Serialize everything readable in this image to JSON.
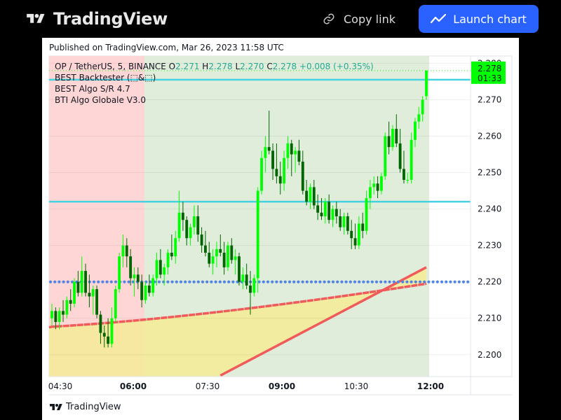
{
  "header": {
    "brand": "TradingView",
    "copy_link_label": "Copy link",
    "launch_label": "Launch chart"
  },
  "published_text": "Published on TradingView.com, Mar 26, 2023 11:58 UTC",
  "footer_brand": "TradingView",
  "legend": {
    "symbol": "OP / TetherUS, 5, BINANCE",
    "o_label": "O",
    "o_value": "2.271",
    "h_label": "H",
    "h_value": "2.278",
    "l_label": "L",
    "l_value": "2.270",
    "c_label": "C",
    "c_value": "2.278",
    "change": "+0.008 (+0.35%)",
    "indicators": [
      "BEST Backtester (⬚&⬚)",
      "BEST Algo S/R 4.7",
      "BTI Algo Globale V3.0"
    ]
  },
  "price_badge": {
    "price": "2.278",
    "countdown": "01:33"
  },
  "colors": {
    "up": "#00ff00",
    "down": "#006400",
    "accent": "#2962ff",
    "sr_line": "#44d2e0",
    "dots": "#4f83e6",
    "ma_red": "#f15a5a",
    "zone_red": "#ffd6d6",
    "zone_green": "#e1eddb",
    "fill_yellow": "#f5eb96"
  },
  "chart_data": {
    "type": "candlestick",
    "quote_unit": "USDT",
    "ylim": [
      2.194,
      2.282
    ],
    "y_ticks": [
      "2.280",
      "2.270",
      "2.260",
      "2.250",
      "2.240",
      "2.230",
      "2.220",
      "2.210",
      "2.200"
    ],
    "x_ticks": [
      {
        "label": "04:30",
        "bold": false
      },
      {
        "label": "06:00",
        "bold": true
      },
      {
        "label": "07:30",
        "bold": false
      },
      {
        "label": "09:00",
        "bold": true
      },
      {
        "label": "10:30",
        "bold": false
      },
      {
        "label": "12:00",
        "bold": true
      }
    ],
    "sr_levels": [
      2.2755,
      2.242
    ],
    "dotted_level": 2.22,
    "candles": [
      [
        2.21,
        2.214,
        2.208,
        2.212
      ],
      [
        2.212,
        2.213,
        2.207,
        2.209
      ],
      [
        2.209,
        2.213,
        2.207,
        2.212
      ],
      [
        2.212,
        2.215,
        2.209,
        2.211
      ],
      [
        2.211,
        2.216,
        2.21,
        2.215
      ],
      [
        2.215,
        2.218,
        2.212,
        2.214
      ],
      [
        2.214,
        2.221,
        2.213,
        2.22
      ],
      [
        2.22,
        2.223,
        2.216,
        2.217
      ],
      [
        2.217,
        2.227,
        2.216,
        2.223
      ],
      [
        2.223,
        2.225,
        2.216,
        2.217
      ],
      [
        2.217,
        2.222,
        2.213,
        2.216
      ],
      [
        2.216,
        2.219,
        2.211,
        2.218
      ],
      [
        2.218,
        2.219,
        2.21,
        2.211
      ],
      [
        2.211,
        2.212,
        2.203,
        2.206
      ],
      [
        2.206,
        2.208,
        2.202,
        2.205
      ],
      [
        2.205,
        2.21,
        2.202,
        2.203
      ],
      [
        2.203,
        2.213,
        2.202,
        2.21
      ],
      [
        2.21,
        2.219,
        2.209,
        2.218
      ],
      [
        2.218,
        2.228,
        2.217,
        2.227
      ],
      [
        2.227,
        2.233,
        2.224,
        2.23
      ],
      [
        2.23,
        2.232,
        2.224,
        2.227
      ],
      [
        2.227,
        2.229,
        2.219,
        2.221
      ],
      [
        2.221,
        2.224,
        2.216,
        2.222
      ],
      [
        2.222,
        2.224,
        2.218,
        2.22
      ],
      [
        2.22,
        2.222,
        2.213,
        2.215
      ],
      [
        2.215,
        2.22,
        2.214,
        2.219
      ],
      [
        2.219,
        2.222,
        2.216,
        2.217
      ],
      [
        2.217,
        2.222,
        2.216,
        2.221
      ],
      [
        2.221,
        2.228,
        2.219,
        2.226
      ],
      [
        2.226,
        2.229,
        2.221,
        2.222
      ],
      [
        2.222,
        2.225,
        2.219,
        2.224
      ],
      [
        2.224,
        2.229,
        2.222,
        2.228
      ],
      [
        2.228,
        2.233,
        2.226,
        2.227
      ],
      [
        2.227,
        2.234,
        2.225,
        2.232
      ],
      [
        2.232,
        2.245,
        2.231,
        2.239
      ],
      [
        2.239,
        2.242,
        2.234,
        2.237
      ],
      [
        2.237,
        2.238,
        2.23,
        2.232
      ],
      [
        2.232,
        2.236,
        2.23,
        2.235
      ],
      [
        2.235,
        2.241,
        2.233,
        2.238
      ],
      [
        2.238,
        2.241,
        2.231,
        2.233
      ],
      [
        2.233,
        2.235,
        2.228,
        2.23
      ],
      [
        2.23,
        2.234,
        2.227,
        2.228
      ],
      [
        2.228,
        2.231,
        2.224,
        2.225
      ],
      [
        2.225,
        2.229,
        2.222,
        2.227
      ],
      [
        2.227,
        2.231,
        2.224,
        2.229
      ],
      [
        2.229,
        2.233,
        2.227,
        2.228
      ],
      [
        2.228,
        2.231,
        2.222,
        2.224
      ],
      [
        2.224,
        2.231,
        2.223,
        2.23
      ],
      [
        2.23,
        2.232,
        2.225,
        2.226
      ],
      [
        2.226,
        2.229,
        2.222,
        2.227
      ],
      [
        2.227,
        2.228,
        2.219,
        2.22
      ],
      [
        2.22,
        2.224,
        2.218,
        2.222
      ],
      [
        2.222,
        2.225,
        2.218,
        2.219
      ],
      [
        2.219,
        2.223,
        2.211,
        2.217
      ],
      [
        2.217,
        2.222,
        2.216,
        2.221
      ],
      [
        2.221,
        2.246,
        2.217,
        2.245
      ],
      [
        2.245,
        2.256,
        2.244,
        2.254
      ],
      [
        2.254,
        2.26,
        2.25,
        2.257
      ],
      [
        2.257,
        2.267,
        2.255,
        2.256
      ],
      [
        2.256,
        2.258,
        2.248,
        2.251
      ],
      [
        2.251,
        2.258,
        2.247,
        2.249
      ],
      [
        2.249,
        2.253,
        2.244,
        2.247
      ],
      [
        2.247,
        2.256,
        2.245,
        2.254
      ],
      [
        2.254,
        2.26,
        2.251,
        2.258
      ],
      [
        2.258,
        2.259,
        2.249,
        2.255
      ],
      [
        2.255,
        2.257,
        2.25,
        2.256
      ],
      [
        2.256,
        2.259,
        2.252,
        2.253
      ],
      [
        2.253,
        2.256,
        2.244,
        2.245
      ],
      [
        2.245,
        2.248,
        2.241,
        2.242
      ],
      [
        2.242,
        2.247,
        2.24,
        2.246
      ],
      [
        2.246,
        2.248,
        2.24,
        2.241
      ],
      [
        2.241,
        2.244,
        2.237,
        2.239
      ],
      [
        2.239,
        2.243,
        2.237,
        2.238
      ],
      [
        2.238,
        2.243,
        2.236,
        2.242
      ],
      [
        2.242,
        2.244,
        2.236,
        2.237
      ],
      [
        2.237,
        2.241,
        2.235,
        2.24
      ],
      [
        2.24,
        2.242,
        2.236,
        2.238
      ],
      [
        2.238,
        2.24,
        2.234,
        2.235
      ],
      [
        2.235,
        2.239,
        2.233,
        2.238
      ],
      [
        2.238,
        2.239,
        2.233,
        2.234
      ],
      [
        2.234,
        2.237,
        2.229,
        2.232
      ],
      [
        2.232,
        2.236,
        2.229,
        2.23
      ],
      [
        2.23,
        2.238,
        2.229,
        2.236
      ],
      [
        2.236,
        2.239,
        2.232,
        2.234
      ],
      [
        2.234,
        2.245,
        2.233,
        2.243
      ],
      [
        2.243,
        2.248,
        2.24,
        2.246
      ],
      [
        2.246,
        2.249,
        2.244,
        2.247
      ],
      [
        2.247,
        2.249,
        2.243,
        2.245
      ],
      [
        2.245,
        2.25,
        2.244,
        2.249
      ],
      [
        2.249,
        2.261,
        2.248,
        2.26
      ],
      [
        2.26,
        2.264,
        2.255,
        2.257
      ],
      [
        2.257,
        2.263,
        2.256,
        2.262
      ],
      [
        2.262,
        2.266,
        2.257,
        2.258
      ],
      [
        2.258,
        2.262,
        2.25,
        2.251
      ],
      [
        2.251,
        2.256,
        2.247,
        2.248
      ],
      [
        2.248,
        2.25,
        2.247,
        2.248
      ],
      [
        2.248,
        2.261,
        2.247,
        2.259
      ],
      [
        2.259,
        2.265,
        2.257,
        2.264
      ],
      [
        2.264,
        2.268,
        2.262,
        2.266
      ],
      [
        2.266,
        2.271,
        2.264,
        2.27
      ],
      [
        2.271,
        2.278,
        2.27,
        2.278
      ]
    ]
  }
}
